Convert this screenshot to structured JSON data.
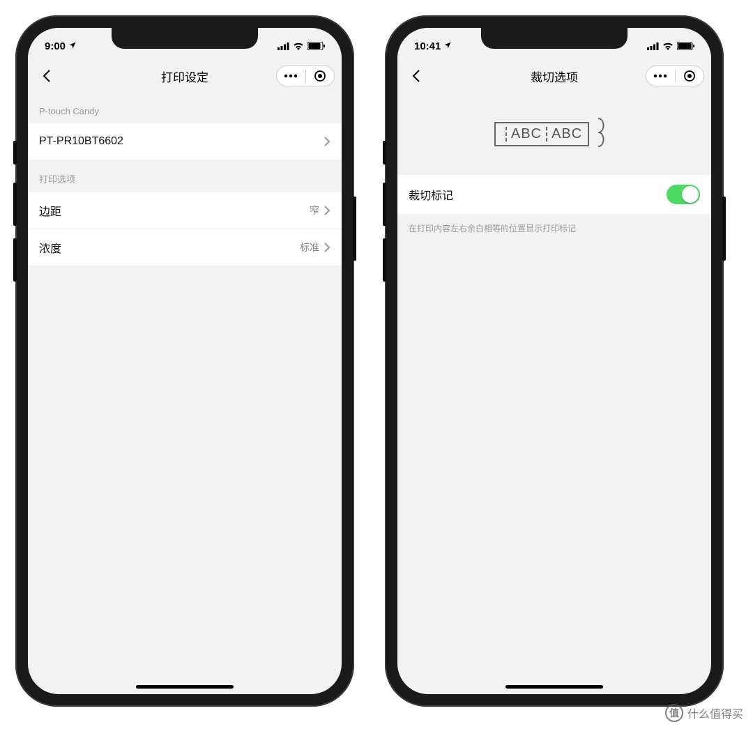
{
  "left": {
    "status": {
      "time": "9:00"
    },
    "nav": {
      "title": "打印设定"
    },
    "section1": {
      "label": "P-touch Candy",
      "printer": "PT-PR10BT6602"
    },
    "section2": {
      "label": "打印选项",
      "margin": {
        "label": "边距",
        "value": "窄"
      },
      "density": {
        "label": "浓度",
        "value": "标准"
      }
    }
  },
  "right": {
    "status": {
      "time": "10:41"
    },
    "nav": {
      "title": "裁切选项"
    },
    "preview": {
      "sample": "ABC"
    },
    "cutmark": {
      "label": "裁切标记",
      "on": true,
      "hint": "在打印内容左右余白相等的位置显示打印标记"
    }
  },
  "watermark": {
    "badge": "值",
    "text": "什么值得买"
  }
}
